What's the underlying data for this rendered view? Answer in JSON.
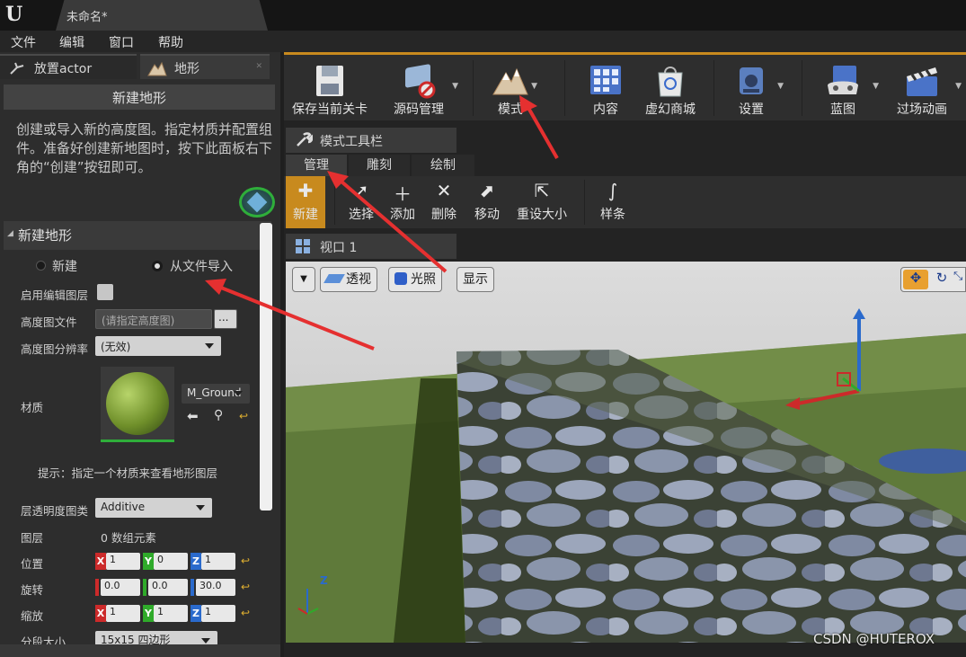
{
  "window": {
    "logo": "U",
    "doc_tab": "未命名*"
  },
  "menu": [
    "文件",
    "编辑",
    "窗口",
    "帮助"
  ],
  "left_tabs": {
    "place": "放置actor",
    "landscape": "地形"
  },
  "landscape": {
    "header": "新建地形",
    "description": "创建或导入新的高度图。指定材质并配置组件。准备好创建新地图时，按下此面板右下角的“创建”按钮即可。",
    "section": "新建地形",
    "radio_new": "新建",
    "radio_import": "从文件导入",
    "enable_layers_label": "启用编辑图层",
    "heightmap_file_label": "高度图文件",
    "heightmap_file_placeholder": "(请指定高度图)",
    "browse": "...",
    "heightmap_res_label": "高度图分辨率",
    "heightmap_res_value": "(无效)",
    "material_label": "材质",
    "material_value": "M_Ground",
    "hint": "提示：指定一个材质来查看地形图层",
    "layer_blend_label": "层透明度图类",
    "layer_blend_value": "Additive",
    "layers_label": "图层",
    "layers_value": "0 数组元素",
    "location_label": "位置",
    "location": {
      "x": "1",
      "y": "0",
      "z": "1"
    },
    "rotation_label": "旋转",
    "rotation": {
      "x": "0.0",
      "y": "0.0",
      "z": "30.0"
    },
    "scale_label": "缩放",
    "scale": {
      "x": "1",
      "y": "1",
      "z": "1"
    },
    "section_size_label": "分段大小",
    "section_size_value": "15x15 四边形"
  },
  "toolbar": [
    {
      "id": "save",
      "label": "保存当前关卡"
    },
    {
      "id": "source",
      "label": "源码管理"
    },
    {
      "id": "modes",
      "label": "模式"
    },
    {
      "id": "content",
      "label": "内容"
    },
    {
      "id": "market",
      "label": "虚幻商城"
    },
    {
      "id": "settings",
      "label": "设置"
    },
    {
      "id": "blueprint",
      "label": "蓝图"
    },
    {
      "id": "cinematic",
      "label": "过场动画"
    }
  ],
  "modes_toolbar": {
    "title": "模式工具栏",
    "tabs": [
      "管理",
      "雕刻",
      "绘制"
    ]
  },
  "tools": [
    "新建",
    "选择",
    "添加",
    "删除",
    "移动",
    "重设大小",
    "样条"
  ],
  "viewport": {
    "title": "视口 1",
    "perspective": "透视",
    "lit": "光照",
    "show": "显示",
    "axis_z": "Z"
  },
  "watermark": "CSDN @HUTEROX",
  "colors": {
    "accent": "#c88a1e",
    "annotation_arrow": "#e53030",
    "axis_x": "#cc2a2a",
    "axis_y": "#2faa2a",
    "axis_z": "#2a6acc"
  }
}
